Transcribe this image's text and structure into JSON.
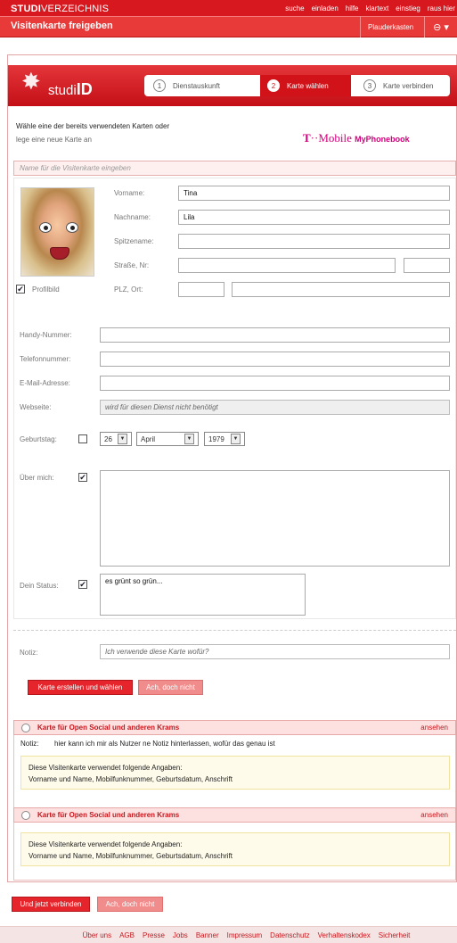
{
  "header": {
    "brand_bold": "STUDI",
    "brand_rest": "VERZEICHNIS",
    "nav": [
      "suche",
      "einladen",
      "hilfe",
      "klartext",
      "einstieg",
      "raus hier"
    ],
    "page_title": "Visitenkarte freigeben",
    "plauderkasten": "Plauderkasten"
  },
  "studiid": {
    "logo_prefix": "studi",
    "logo_suffix": "ID",
    "steps": [
      {
        "num": "1",
        "label": "Dienstauskunft",
        "active": false
      },
      {
        "num": "2",
        "label": "Karte wählen",
        "active": true
      },
      {
        "num": "3",
        "label": "Karte verbinden",
        "active": false
      }
    ]
  },
  "intro": {
    "line1": "Wähle eine der bereits verwendeten Karten oder",
    "line2": "lege eine neue Karte an",
    "partner_t": "T",
    "partner_dots": "··",
    "partner_mobile": "Mobile",
    "partner_service": "MyPhonebook"
  },
  "card_name_placeholder": "Name für die Visitenkarte eingeben",
  "form": {
    "vorname_label": "Vorname:",
    "vorname_value": "Tina",
    "nachname_label": "Nachname:",
    "nachname_value": "Lila",
    "spitzname_label": "Spitzename:",
    "strasse_label": "Straße, Nr:",
    "plz_label": "PLZ, Ort:",
    "profilbild_label": "Profilbild",
    "profilbild_checked": true,
    "handy_label": "Handy-Nummer:",
    "telefon_label": "Telefonnummer:",
    "email_label": "E-Mail-Adresse:",
    "webseite_label": "Webseite:",
    "webseite_note": "wird für diesen Dienst nicht benötigt",
    "geburtstag_label": "Geburtstag:",
    "geburtstag_checked": false,
    "birth_day": "26",
    "birth_month": "April",
    "birth_year": "1979",
    "ueber_label": "Über mich:",
    "ueber_checked": true,
    "status_label": "Dein Status:",
    "status_checked": true,
    "status_value": "es grünt so grün...",
    "notiz_label": "Notiz:",
    "notiz_placeholder": "Ich verwende diese Karte wofür?",
    "create_button": "Karte erstellen und wählen",
    "cancel_button": "Ach, doch nicht"
  },
  "cards": [
    {
      "title": "Karte für Open Social und anderen Krams",
      "link": "ansehen",
      "note_label": "Notiz:",
      "note": "hier kann ich mir als Nutzer ne Notiz hinterlassen, wofür das genau ist",
      "info_line1": "Diese Visitenkarte verwendet folgende Angaben:",
      "info_line2": "Vorname und Name, Mobilfunknummer, Geburtsdatum, Anschrift"
    },
    {
      "title": "Karte für Open Social und anderen Krams",
      "link": "ansehen",
      "info_line1": "Diese Visitenkarte verwendet folgende Angaben:",
      "info_line2": "Vorname und Name, Mobilfunknummer, Geburtsdatum, Anschrift"
    }
  ],
  "bottom": {
    "connect_button": "Und jetzt verbinden",
    "cancel_button": "Ach, doch nicht"
  },
  "footer": [
    "Über uns",
    "AGB",
    "Presse",
    "Jobs",
    "Banner",
    "Impressum",
    "Datenschutz",
    "Verhaltenskodex",
    "Sicherheit"
  ]
}
